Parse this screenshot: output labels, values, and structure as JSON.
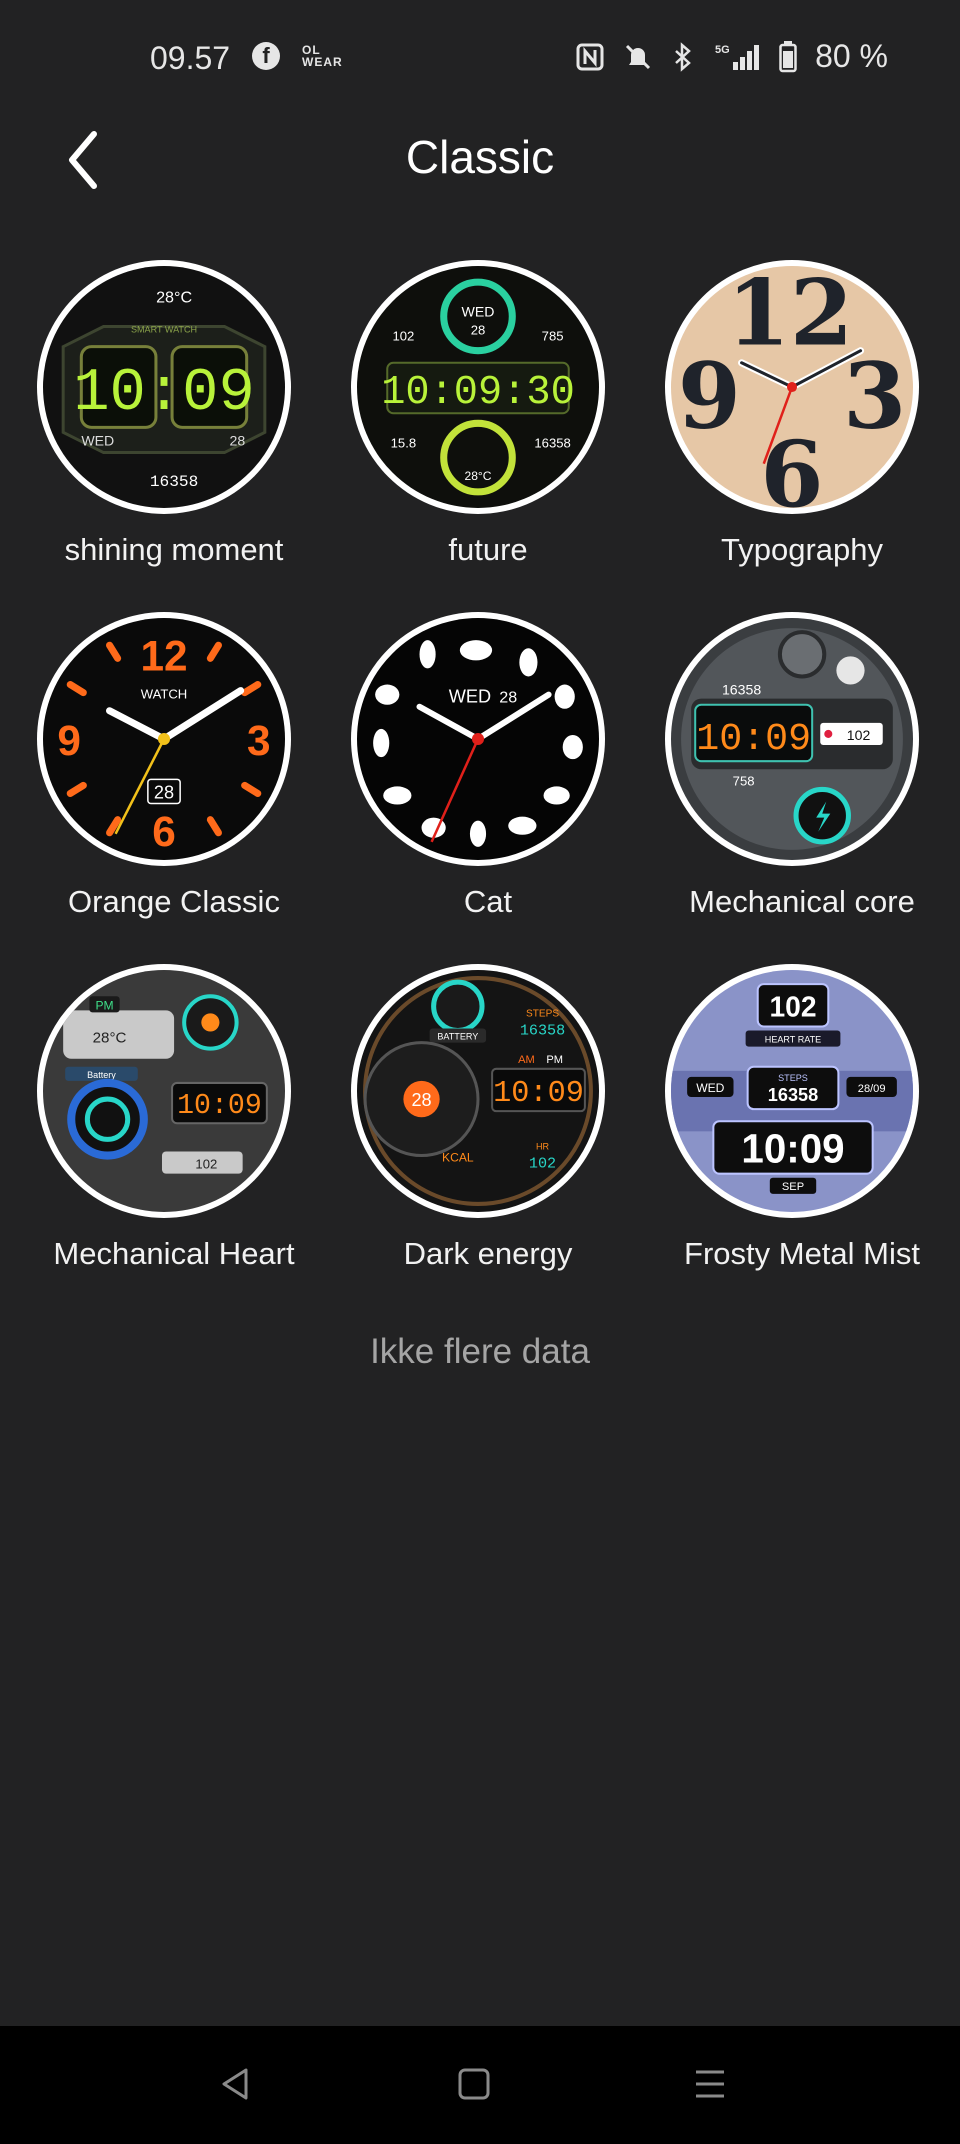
{
  "status_bar": {
    "time": "09.57",
    "wear_label": "OL\nWEAR",
    "battery_percent": "80 %",
    "network": "5G"
  },
  "header": {
    "title": "Classic"
  },
  "faces": [
    {
      "label": "shining moment",
      "texts": {
        "temp": "28°C",
        "brand": "SMART WATCH",
        "time": "10:09",
        "day": "WED",
        "date": "28",
        "steps": "16358"
      }
    },
    {
      "label": "future",
      "texts": {
        "day": "WED",
        "date": "28",
        "left": "102",
        "right": "785",
        "time": "10:09:30",
        "bl": "15.8",
        "br": "16358",
        "temp": "28°C"
      }
    },
    {
      "label": "Typography",
      "texts": {
        "n12": "12",
        "n9": "9",
        "n3": "3",
        "n6": "6"
      }
    },
    {
      "label": "Orange Classic",
      "texts": {
        "n12": "12",
        "n9": "9",
        "n3": "3",
        "n6": "6",
        "brand": "WATCH",
        "date": "28"
      }
    },
    {
      "label": "Cat",
      "texts": {
        "day": "WED",
        "date": "28"
      }
    },
    {
      "label": "Mechanical core",
      "texts": {
        "steps": "16358",
        "time": "10:09",
        "hr": "102",
        "kcal": "758"
      }
    },
    {
      "label": "Mechanical Heart",
      "texts": {
        "ampm": "PM",
        "temp": "28°C",
        "battery": "Battery",
        "time": "10:09",
        "hr": "102"
      }
    },
    {
      "label": "Dark energy",
      "texts": {
        "battery": "BATTERY",
        "steps_label": "STEPS",
        "steps": "16358",
        "am": "AM",
        "pm": "PM",
        "time": "10:09",
        "kcal": "KCAL",
        "hr_label": "HR",
        "hr": "102",
        "date": "28"
      }
    },
    {
      "label": "Frosty Metal Mist",
      "texts": {
        "hr": "102",
        "hr_label": "HEART RATE",
        "day": "WED",
        "steps_label": "STEPS",
        "steps": "16358",
        "date": "28/09",
        "time": "10:09",
        "month": "SEP"
      }
    }
  ],
  "footer_text": "Ikke flere data",
  "colors": {
    "background": "#222223",
    "nav_bar": "#000000",
    "lcd_green": "#b8f23a",
    "orange": "#ff6a1a",
    "cyan": "#28d6c8"
  }
}
